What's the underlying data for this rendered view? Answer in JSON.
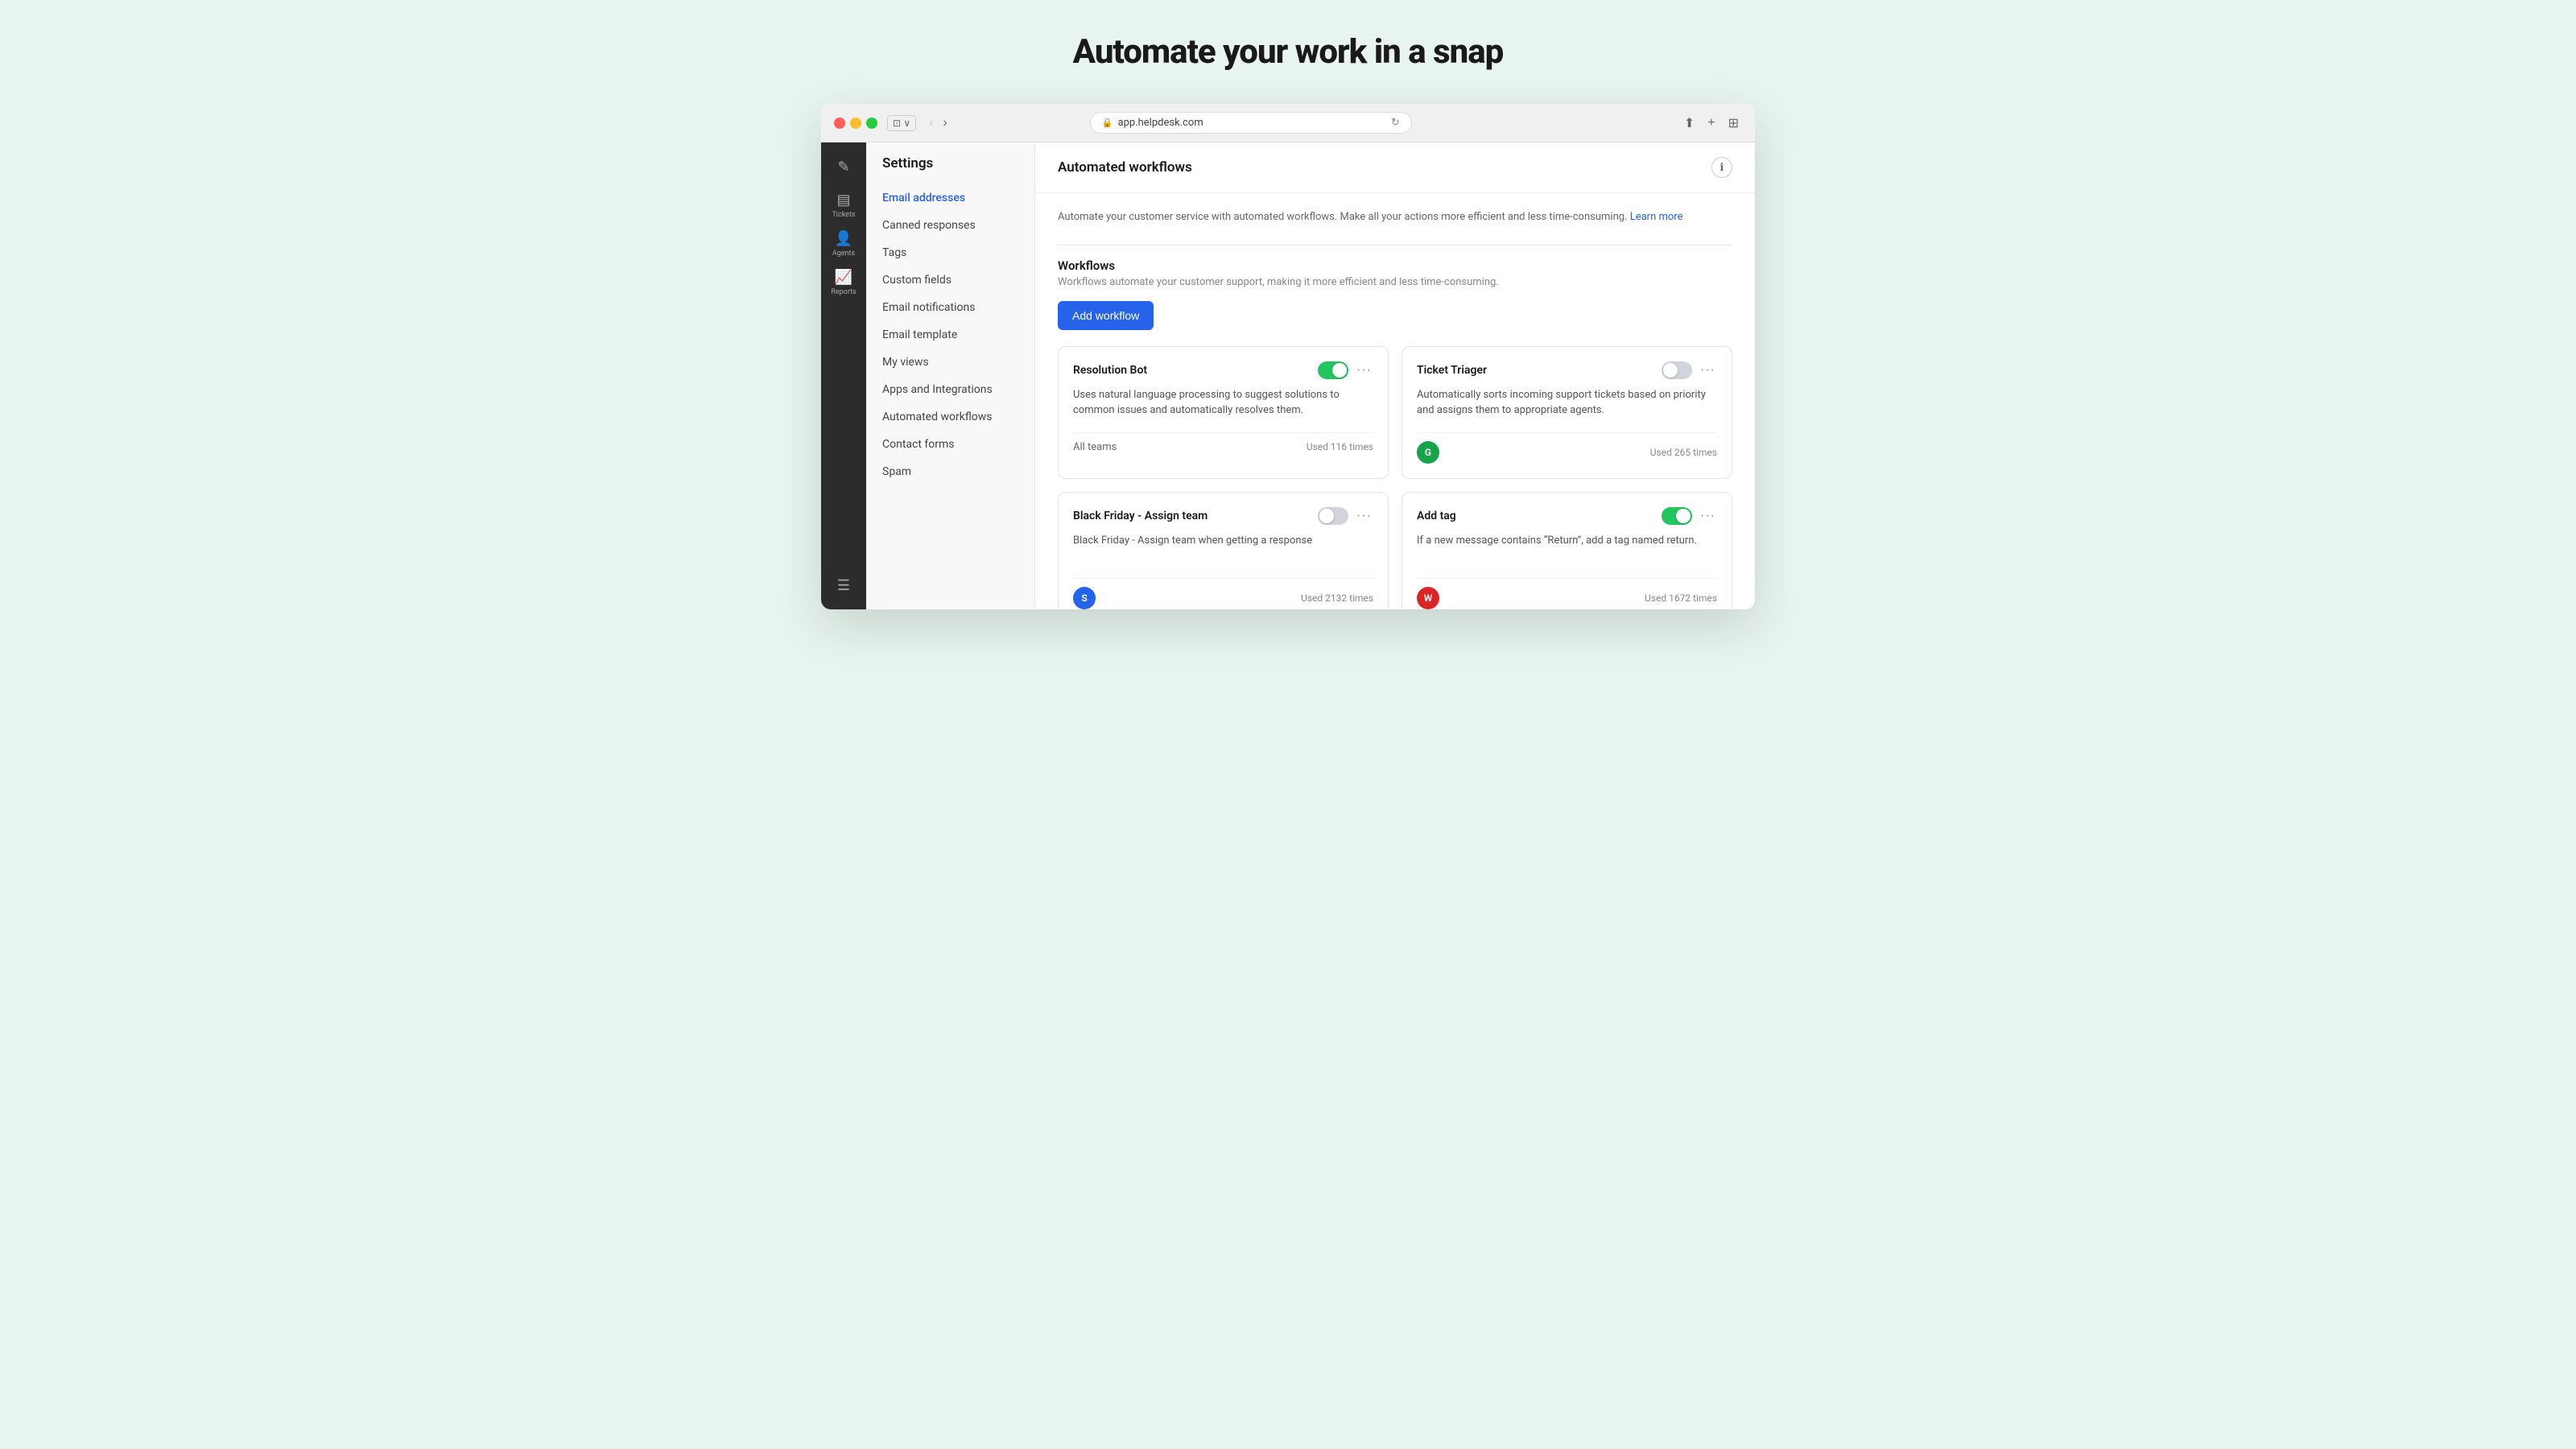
{
  "page": {
    "heading": "Automate your work in a snap",
    "browser_url": "app.helpdesk.com"
  },
  "browser": {
    "back_arrow": "‹",
    "forward_arrow": "›"
  },
  "nav": {
    "items": [
      {
        "id": "tickets",
        "icon": "✎",
        "label": "Tickets"
      },
      {
        "id": "agents",
        "icon": "👤",
        "label": "Agents"
      },
      {
        "id": "reports",
        "icon": "📈",
        "label": "Reports"
      }
    ]
  },
  "sidebar": {
    "title": "Settings",
    "items": [
      {
        "id": "email-addresses",
        "label": "Email addresses",
        "active": true
      },
      {
        "id": "canned-responses",
        "label": "Canned responses",
        "active": false
      },
      {
        "id": "tags",
        "label": "Tags",
        "active": false
      },
      {
        "id": "custom-fields",
        "label": "Custom fields",
        "active": false
      },
      {
        "id": "email-notifications",
        "label": "Email notifications",
        "active": false
      },
      {
        "id": "email-template",
        "label": "Email template",
        "active": false
      },
      {
        "id": "my-views",
        "label": "My views",
        "active": false
      },
      {
        "id": "apps-integrations",
        "label": "Apps and Integrations",
        "active": false
      },
      {
        "id": "automated-workflows",
        "label": "Automated workflows",
        "active": false
      },
      {
        "id": "contact-forms",
        "label": "Contact forms",
        "active": false
      },
      {
        "id": "spam",
        "label": "Spam",
        "active": false
      }
    ]
  },
  "main": {
    "header_title": "Automated workflows",
    "description": "Automate your customer service with automated workflows. Make all your actions more efficient and less time-consuming.",
    "learn_more_label": "Learn more",
    "section_title": "Workflows",
    "section_subtitle": "Workflows automate your customer support, making it more efficient and less time-consuming.",
    "add_workflow_label": "Add workflow",
    "workflows": [
      {
        "id": "resolution-bot",
        "title": "Resolution Bot",
        "description": "Uses natural language processing to suggest solutions to common issues and automatically resolves them.",
        "toggle": "on",
        "team": "All teams",
        "used_label": "Used 116 times",
        "avatar": null
      },
      {
        "id": "ticket-triager",
        "title": "Ticket Triager",
        "description": "Automatically sorts incoming support tickets based on priority and assigns them to appropriate agents.",
        "toggle": "off",
        "team": null,
        "used_label": "Used 265 times",
        "avatar": {
          "letter": "G",
          "color": "green"
        }
      },
      {
        "id": "black-friday",
        "title": "Black Friday - Assign team",
        "description": "Black Friday - Assign team when getting a response",
        "toggle": "off",
        "team": null,
        "used_label": "Used 2132 times",
        "avatar": {
          "letter": "S",
          "color": "blue"
        }
      },
      {
        "id": "add-tag",
        "title": "Add tag",
        "description": "If a new message contains “Return”, add a tag named return.",
        "toggle": "on",
        "team": null,
        "used_label": "Used 1672 times",
        "avatar": {
          "letter": "W",
          "color": "red"
        }
      }
    ]
  }
}
